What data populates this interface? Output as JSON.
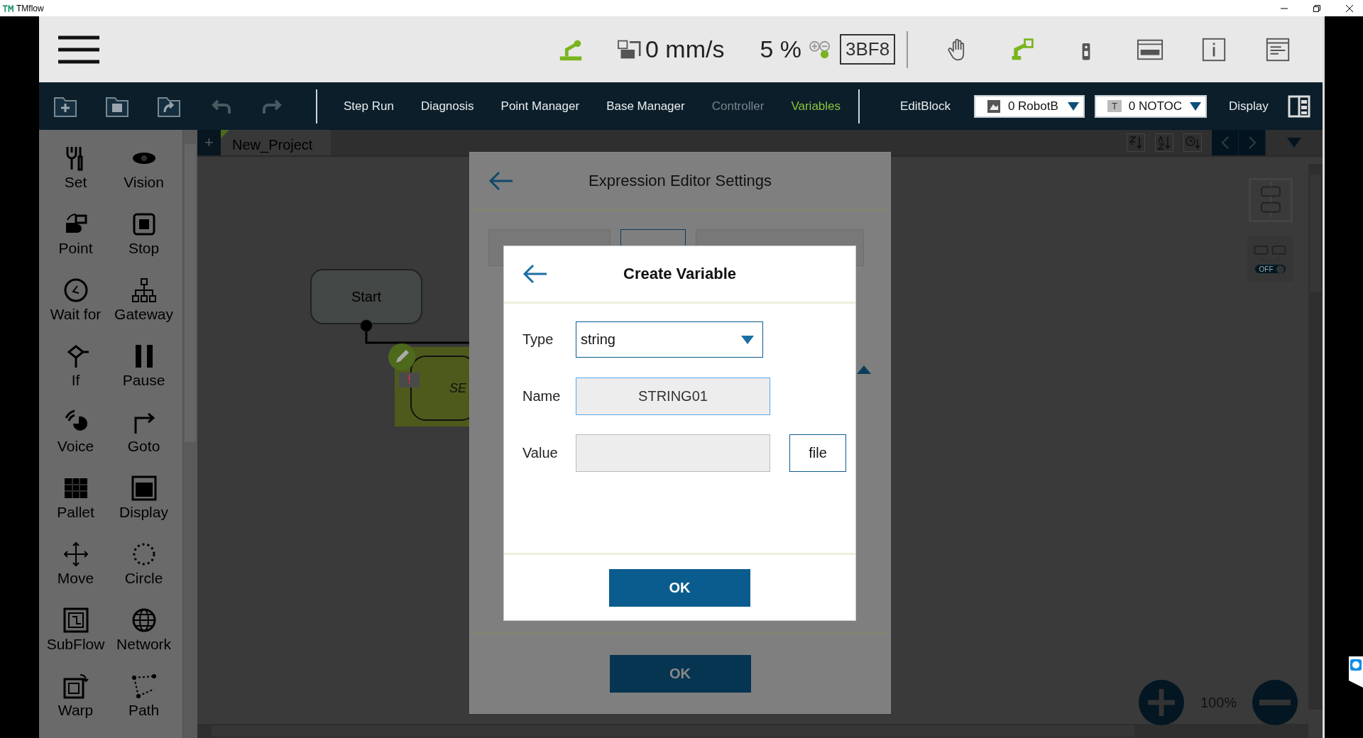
{
  "window": {
    "title": "TMflow"
  },
  "status": {
    "speed": "0 mm/s",
    "percent": "5 %",
    "code": "3BF8"
  },
  "toolbar": {
    "menu": [
      {
        "label": "Step Run",
        "disabled": false,
        "selected": false
      },
      {
        "label": "Diagnosis",
        "disabled": false,
        "selected": false
      },
      {
        "label": "Point Manager",
        "disabled": false,
        "selected": false
      },
      {
        "label": "Base Manager",
        "disabled": false,
        "selected": false
      },
      {
        "label": "Controller",
        "disabled": true,
        "selected": false
      },
      {
        "label": "Variables",
        "disabled": false,
        "selected": true
      }
    ],
    "editblock": "EditBlock",
    "base_select": "0 RobotB",
    "tool_badge": "T",
    "tool_select": "0 NOTOC",
    "display": "Display"
  },
  "project_tab": {
    "add": "+",
    "name": "New_Project"
  },
  "sidebar": {
    "items": [
      {
        "label": "Set"
      },
      {
        "label": "Vision"
      },
      {
        "label": "Point"
      },
      {
        "label": "Stop"
      },
      {
        "label": "Wait for"
      },
      {
        "label": "Gateway"
      },
      {
        "label": "If"
      },
      {
        "label": "Pause"
      },
      {
        "label": "Voice"
      },
      {
        "label": "Goto"
      },
      {
        "label": "Pallet"
      },
      {
        "label": "Display"
      },
      {
        "label": "Move"
      },
      {
        "label": "Circle"
      },
      {
        "label": "SubFlow"
      },
      {
        "label": "Network"
      },
      {
        "label": "Warp"
      },
      {
        "label": "Path"
      }
    ]
  },
  "canvas": {
    "start": "Start",
    "node_label": "SE",
    "warning": "!",
    "toggle": {
      "label": "OFF",
      "on": false
    },
    "zoom": "100%"
  },
  "expression_dialog": {
    "title": "Expression Editor Settings",
    "ok": "OK"
  },
  "create_variable": {
    "title": "Create Variable",
    "fields": [
      {
        "kind": "select",
        "label": "Type",
        "value": "string"
      },
      {
        "kind": "text",
        "label": "Name",
        "value": "STRING01"
      },
      {
        "kind": "file",
        "label": "Value",
        "button": "file"
      }
    ],
    "ok": "OK"
  }
}
